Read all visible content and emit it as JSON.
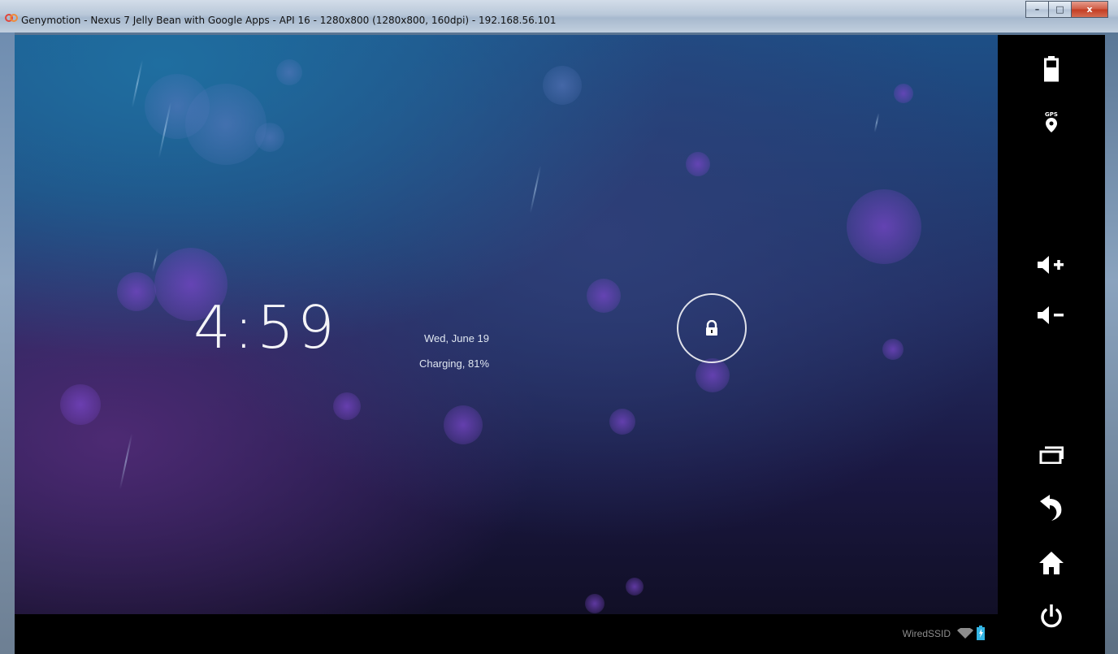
{
  "window": {
    "title": "Genymotion - Nexus 7 Jelly Bean with Google Apps - API 16 - 1280x800 (1280x800, 160dpi) - 192.168.56.101",
    "controls": {
      "minimize": "–",
      "maximize": "□",
      "close": "x"
    }
  },
  "lockscreen": {
    "time": "4:59",
    "date": "Wed, June 19",
    "charging": "Charging, 81%"
  },
  "statusbar": {
    "ssid": "WiredSSID"
  },
  "sidebar": {
    "gps_label": "GPS",
    "icons": [
      "battery-icon",
      "gps-icon",
      "volume-up-icon",
      "volume-down-icon",
      "recent-apps-icon",
      "back-icon",
      "home-icon",
      "power-icon"
    ]
  },
  "colors": {
    "accent_orb": "#7846c8",
    "wallpaper_top": "#1d4f86",
    "wallpaper_bottom": "#110f26"
  }
}
